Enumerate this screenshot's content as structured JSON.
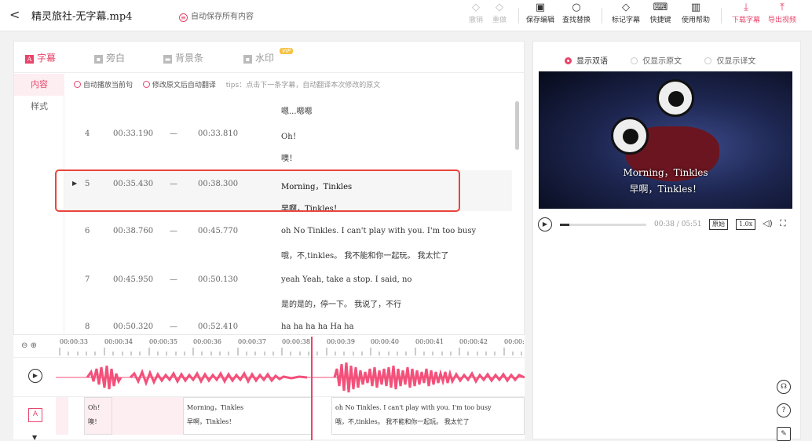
{
  "header": {
    "back": "<",
    "title": "精灵旅社-无字幕.mp4",
    "autosave": "自动保存所有内容",
    "toolbar": [
      {
        "label": "撤销",
        "icon": "undo-icon",
        "state": "disabled"
      },
      {
        "label": "重做",
        "icon": "redo-icon",
        "state": "disabled"
      },
      {
        "label": "保存编辑",
        "icon": "save-icon",
        "state": "normal"
      },
      {
        "label": "查找替换",
        "icon": "search-icon",
        "state": "normal"
      },
      {
        "label": "标记字幕",
        "icon": "mark-icon",
        "state": "normal"
      },
      {
        "label": "快捷键",
        "icon": "keyboard-icon",
        "state": "normal"
      },
      {
        "label": "使用帮助",
        "icon": "help-book-icon",
        "state": "normal"
      },
      {
        "label": "下载字幕",
        "icon": "download-icon",
        "state": "accent"
      },
      {
        "label": "导出视频",
        "icon": "export-icon",
        "state": "accent"
      }
    ]
  },
  "tabs": [
    {
      "label": "字幕",
      "active": true
    },
    {
      "label": "旁白",
      "active": false
    },
    {
      "label": "背景条",
      "active": false
    },
    {
      "label": "水印",
      "active": false,
      "badge": "VIP"
    }
  ],
  "side": [
    {
      "label": "内容",
      "active": true
    },
    {
      "label": "样式",
      "active": false
    }
  ],
  "options": {
    "opt1": "自动播放当前句",
    "opt2": "修改原文后自动翻译",
    "tips": "tips：点击下一条字幕，自动翻译本次修改的原文"
  },
  "rows": [
    {
      "num": "",
      "start": "",
      "dash": "",
      "end": "",
      "orig": "",
      "trans": "嗯...嗯嗯"
    },
    {
      "num": "4",
      "start": "00:33.190",
      "dash": "—",
      "end": "00:33.810",
      "orig": "Oh！",
      "trans": "噢！"
    },
    {
      "num": "5",
      "start": "00:35.430",
      "dash": "—",
      "end": "00:38.300",
      "orig": "Morning，Tinkles",
      "trans": "早啊，Tinkles！",
      "active": true
    },
    {
      "num": "6",
      "start": "00:38.760",
      "dash": "—",
      "end": "00:45.770",
      "orig": "oh No Tinkles. I can't play with you. I'm too busy",
      "trans": "哦，不,tinkles。 我不能和你一起玩。 我太忙了"
    },
    {
      "num": "7",
      "start": "00:45.950",
      "dash": "—",
      "end": "00:50.130",
      "orig": "yeah Yeah, take a stop. I said, no",
      "trans": "是的是的，停一下。 我说了，不行"
    },
    {
      "num": "8",
      "start": "00:50.320",
      "dash": "—",
      "end": "00:52.410",
      "orig": "ha ha ha ha Ha ha",
      "trans": ""
    }
  ],
  "timeline": {
    "zoom_out": "⊖",
    "zoom_in": "⊕",
    "ticks": [
      "00:00:33",
      "00:00:34",
      "00:00:35",
      "00:00:36",
      "00:00:37",
      "00:00:38",
      "00:00:39",
      "00:00:40",
      "00:00:41",
      "00:00:42",
      "00:00:"
    ],
    "blocks": [
      {
        "orig": "Oh！",
        "trans": "噢！"
      },
      {
        "orig": "Morning，Tinkles",
        "trans": "早啊，Tinkles！"
      },
      {
        "orig": "oh No Tinkles. I can't play with you. I'm too busy",
        "trans": "哦，不,tinkles。 我不能和你一起玩。 我太忙了"
      }
    ],
    "sub_icon": "A"
  },
  "preview": {
    "modes": [
      {
        "label": "显示双语",
        "selected": true
      },
      {
        "label": "仅显示原文",
        "selected": false
      },
      {
        "label": "仅显示译文",
        "selected": false
      }
    ],
    "sub_orig": "Morning，Tinkles",
    "sub_trans": "早啊，Tinkles！",
    "time": "00:38 / 05:51",
    "progress": 0.108,
    "ratio_btn": "原始",
    "speed_btn": "1.0x"
  },
  "colors": {
    "accent": "#e8456b",
    "highlight_box": "#e8453c"
  }
}
